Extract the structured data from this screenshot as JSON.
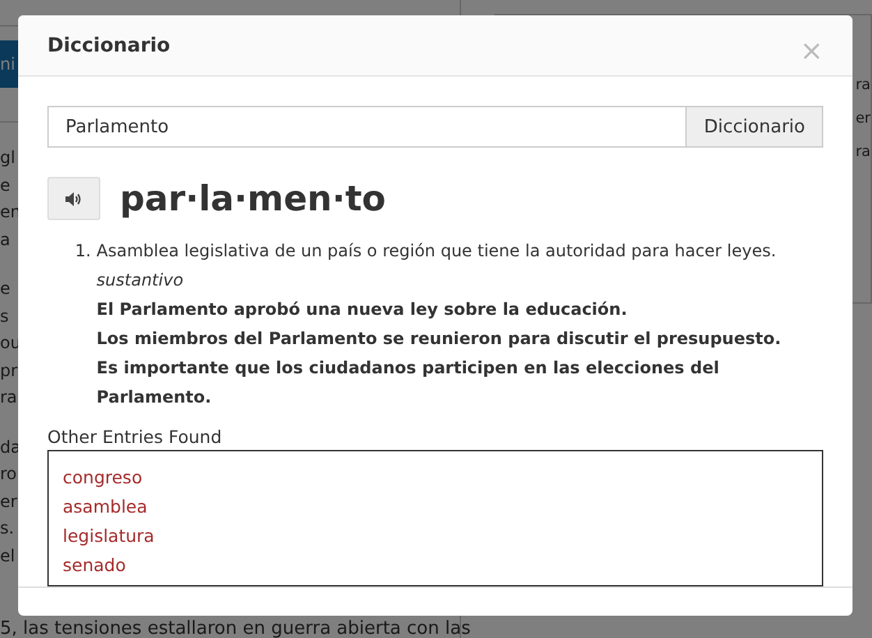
{
  "background": {
    "button": "ni",
    "left_paragraphs": [
      [
        "gl",
        "e",
        "en",
        "a"
      ],
      [
        "e",
        "s",
        "ou",
        "pr",
        "ra"
      ],
      [
        "da",
        "ro",
        "er",
        "s.",
        "el"
      ]
    ],
    "right_lines": [
      "ra",
      "er",
      "ra"
    ],
    "bottom_line": "5, las tensiones estallaron en guerra abierta con las"
  },
  "dialog": {
    "title": "Diccionario",
    "close": "×",
    "search": {
      "value": "Parlamento",
      "button": "Diccionario"
    },
    "headword": "par·la·men·to",
    "definitions": [
      {
        "number": "1.",
        "text": "Asamblea legislativa de un país o región que tiene la autoridad para hacer leyes.",
        "part_of_speech": "sustantivo",
        "examples": [
          "El Parlamento aprobó una nueva ley sobre la educación.",
          "Los miembros del Parlamento se reunieron para discutir el presupuesto.",
          "Es importante que los ciudadanos participen en las elecciones del Parlamento."
        ]
      }
    ],
    "other_entries": {
      "label": "Other Entries Found",
      "items": [
        "congreso",
        "asamblea",
        "legislatura",
        "senado"
      ]
    }
  }
}
